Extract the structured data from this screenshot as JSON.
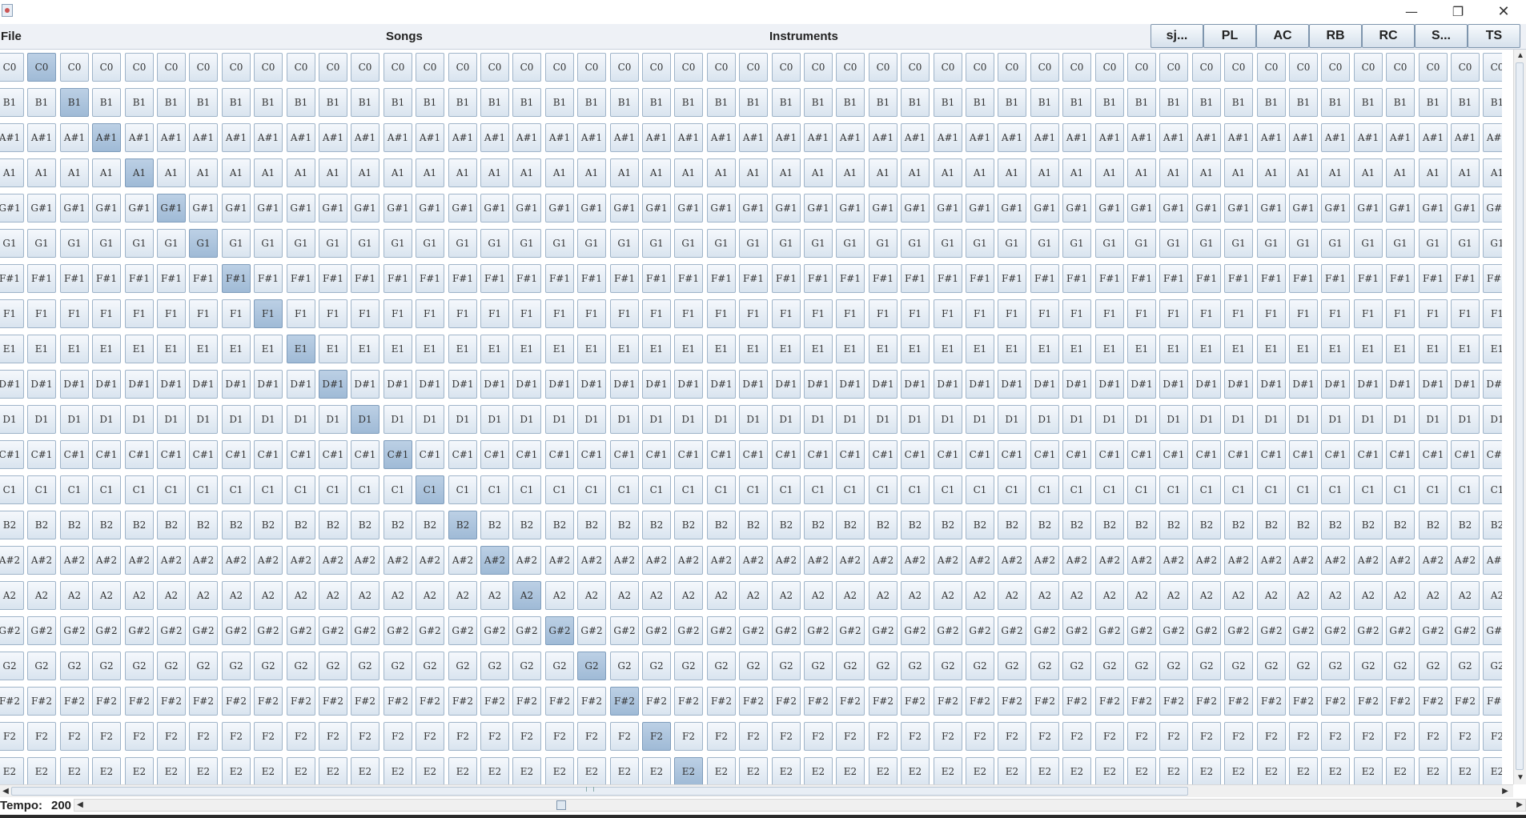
{
  "window": {
    "min_glyph": "—",
    "max_glyph": "❐",
    "close_glyph": "✕"
  },
  "menu": {
    "file": "File",
    "songs": "Songs",
    "instruments": "Instruments"
  },
  "toolbar": [
    "sj...",
    "PL",
    "AC",
    "RB",
    "RC",
    "S...",
    "TS"
  ],
  "grid": {
    "rows": [
      "C0",
      "B1",
      "A#1",
      "A1",
      "G#1",
      "G1",
      "F#1",
      "F1",
      "E1",
      "D#1",
      "D1",
      "C#1",
      "C1",
      "B2",
      "A#2",
      "A2",
      "G#2",
      "G2",
      "F#2",
      "F2",
      "E2"
    ],
    "visible_columns": 47,
    "highlighted_column_per_row": [
      1,
      2,
      3,
      4,
      5,
      6,
      7,
      8,
      9,
      10,
      11,
      12,
      13,
      14,
      15,
      16,
      17,
      18,
      19,
      20,
      21
    ]
  },
  "status": {
    "tempo_label": "Tempo:",
    "tempo_value": "200"
  }
}
